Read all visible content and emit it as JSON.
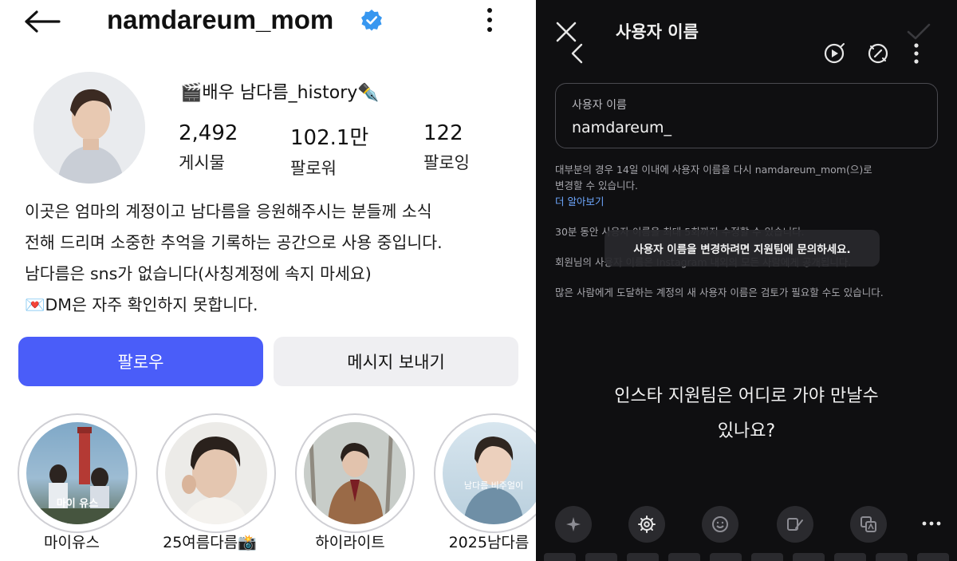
{
  "profile": {
    "username": "namdareum_mom",
    "display_name": "🎬배우 남다름_history✒️",
    "stats": [
      {
        "value": "2,492",
        "label": "게시물"
      },
      {
        "value": "102.1만",
        "label": "팔로워"
      },
      {
        "value": "122",
        "label": "팔로잉"
      }
    ],
    "bio": [
      "이곳은 엄마의 계정이고 남다름을 응원해주시는 분들께 소식",
      "전해 드리며 소중한 추억을 기록하는 공간으로 사용 중입니다.",
      "남다름은 sns가 없습니다(사칭계정에 속지 마세요)",
      "💌DM은 자주 확인하지 못합니다."
    ],
    "follow_label": "팔로우",
    "message_label": "메시지 보내기",
    "highlights": [
      {
        "label": "마이유스",
        "thumb_text": "마이 유스"
      },
      {
        "label": "25여름다름📸",
        "thumb_text": ""
      },
      {
        "label": "하이라이트",
        "thumb_text": ""
      },
      {
        "label": "2025남다름",
        "thumb_text": "남다름 비주얼이"
      }
    ]
  },
  "editor": {
    "title": "사용자 이름",
    "field_label": "사용자 이름",
    "field_value": "namdareum_",
    "info1_line1": "대부분의 경우 14일 이내에 사용자 이름을 다시 namdareum_mom(으)로",
    "info1_line2": "변경할 수 있습니다.",
    "learn_more": "더 알아보기",
    "info2": "30분 동안 사용자 이름을 최대 5회까지 수정할 수 있습니다.",
    "toast": "사용자 이름을 변경하려면 지원팀에 문의하세요.",
    "info3": "회원님의 사용자 이름은 Instagram 내외의 모든 사람에게 공개됩니다.",
    "info4": "많은 사람에게 도달하는 계정의 새 사용자 이름은 검토가 필요할 수도 있습니다.",
    "caption_line1": "인스타 지원팀은 어디로 가야 만날수",
    "caption_line2": "있나요?"
  },
  "colors": {
    "follow_blue": "#4a5df9",
    "verified_blue": "#3797f0",
    "message_gray": "#efeff2",
    "dark_bg": "#0f0f11"
  }
}
